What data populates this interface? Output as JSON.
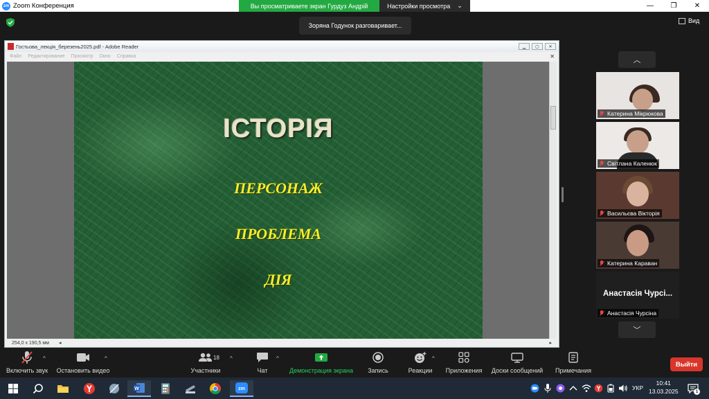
{
  "titlebar": {
    "app_title": "Zoom Конференция",
    "logo_text": "zm",
    "share_banner": "Вы просматриваете экран Гурдуз Андрій",
    "view_settings": "Настройки просмотра",
    "view_settings_caret": "⌄",
    "win_minimize": "—",
    "win_restore": "❐",
    "win_close": "✕"
  },
  "topbar": {
    "speaking_notice": "Зоряна Годунок разговаривает...",
    "view_button": "Вид"
  },
  "reader": {
    "window_title": "Гостьова_лекція_березень2025.pdf - Adobe Reader",
    "win_buttons": [
      "▁",
      "▢",
      "✕"
    ],
    "menu": [
      "Файл",
      "Редактирование",
      "Просмотр",
      "Окно",
      "Справка"
    ],
    "menu_close": "✕",
    "page_size": "254,0 x 190,5 мм",
    "scroll_left": "◂",
    "scroll_right": "▸"
  },
  "slide": {
    "title": "ІСТОРІЯ",
    "items": [
      "ПЕРСОНАЖ",
      "ПРОБЛЕМА",
      "ДІЯ"
    ]
  },
  "participants": {
    "nav_up": "︿",
    "nav_down": "﹀",
    "tiles": [
      {
        "name": "Катерина Мікрюкова",
        "muted": true,
        "video": true
      },
      {
        "name": "Світлана Каленюк",
        "muted": true,
        "video": true
      },
      {
        "name": "Васильєва Вікторія",
        "muted": true,
        "video": true
      },
      {
        "name": "Катерина Караван",
        "muted": true,
        "video": true
      },
      {
        "name": "Анастасія Чурсіна",
        "display_name": "Анастасія Чурсі...",
        "muted": true,
        "video": false
      }
    ]
  },
  "toolbar": {
    "unmute": "Включить звук",
    "stop_video": "Остановить видео",
    "participants": "Участники",
    "participants_count": "18",
    "chat": "Чат",
    "share_screen": "Демонстрация экрана",
    "record": "Запись",
    "reactions": "Реакции",
    "apps": "Приложения",
    "whiteboards": "Доски сообщений",
    "notes": "Примечания",
    "leave": "Выйти",
    "caret": "^"
  },
  "taskbar": {
    "lang": "УКР",
    "time": "10:41",
    "date": "13.03.2025",
    "notif_count": "1",
    "word_letter": "W",
    "zoom_letter": "zm"
  },
  "colors": {
    "zoom_blue": "#2d8cff",
    "share_green": "#23a942",
    "leave_red": "#d9362b",
    "slide_yellow": "#f5ee2a"
  }
}
